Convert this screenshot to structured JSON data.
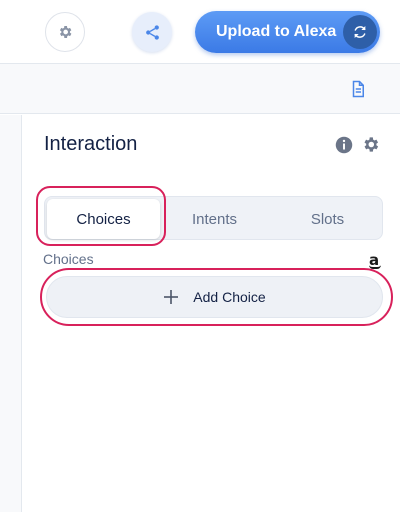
{
  "header": {
    "upload_label": "Upload to Alexa"
  },
  "panel": {
    "title": "Interaction",
    "tabs": [
      {
        "label": "Choices",
        "active": true
      },
      {
        "label": "Intents",
        "active": false
      },
      {
        "label": "Slots",
        "active": false
      }
    ],
    "section_label": "Choices",
    "add_choice_label": "Add Choice",
    "amazon_glyph": "a"
  },
  "colors": {
    "accent": "#3b7ae6",
    "highlight": "#d8215b",
    "text": "#132144",
    "muted": "#62708a"
  },
  "icons": [
    "gear-icon",
    "share-icon",
    "sync-icon",
    "document-icon",
    "info-icon",
    "plus-icon",
    "amazon-icon"
  ]
}
